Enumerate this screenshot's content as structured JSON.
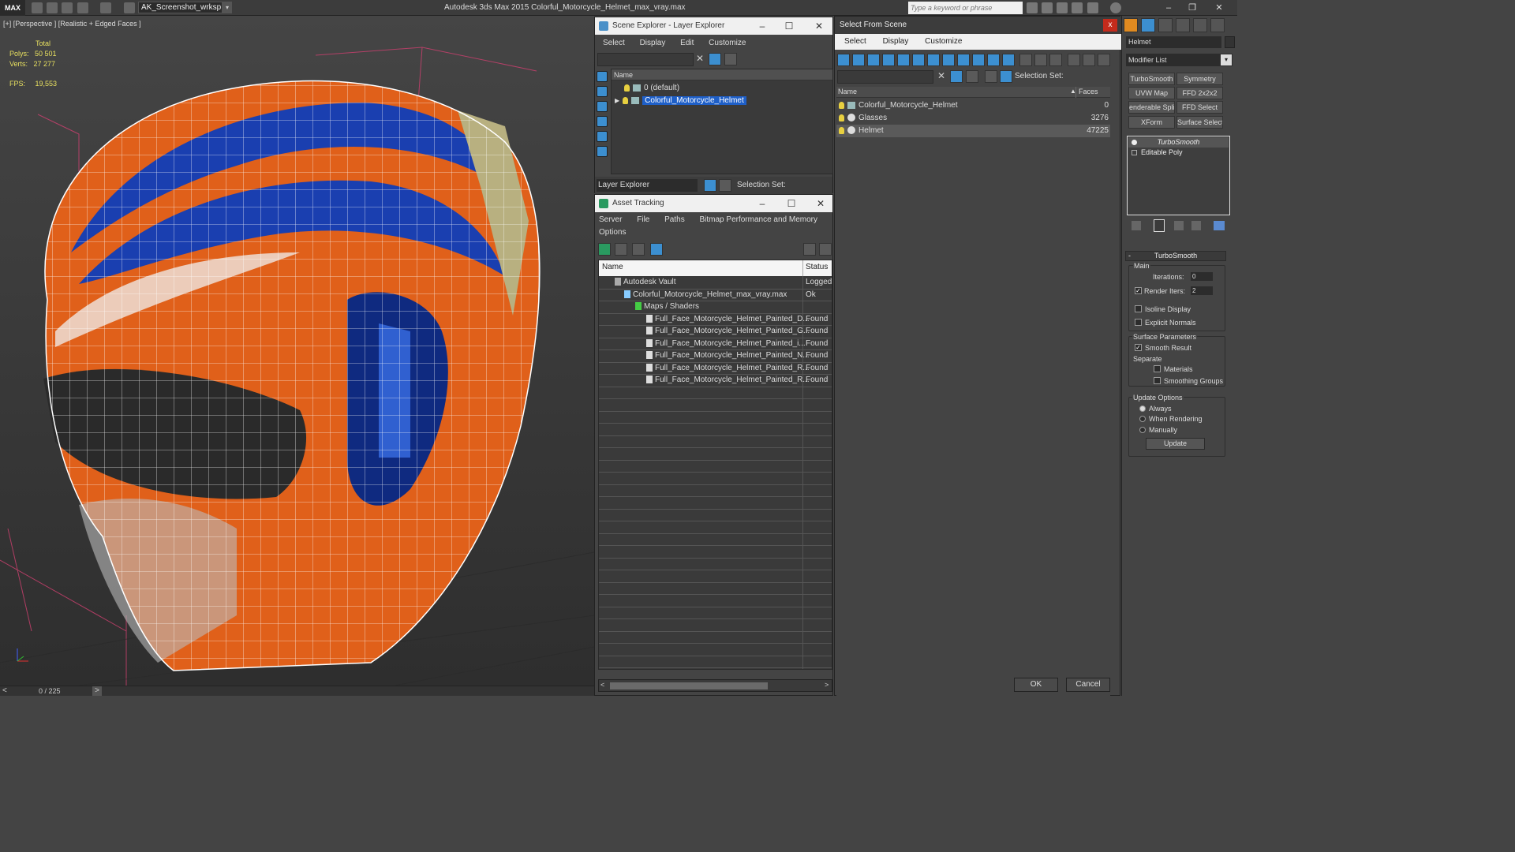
{
  "titlebar": {
    "logo": "MAX",
    "workspace": "AK_Screenshot_wrksp",
    "app_title": "Autodesk 3ds Max  2015    Colorful_Motorcycle_Helmet_max_vray.max",
    "search_placeholder": "Type a keyword or phrase"
  },
  "viewport": {
    "label": "[+] [Perspective ] [Realistic + Edged Faces ]",
    "stats_total": "Total",
    "polys_label": "Polys:",
    "polys_value": "50 501",
    "verts_label": "Verts:",
    "verts_value": "27 277",
    "fps_label": "FPS:",
    "fps_value": "19,553",
    "timeline": "0 / 225"
  },
  "scene_explorer": {
    "title": "Scene Explorer - Layer Explorer",
    "menu": [
      "Select",
      "Display",
      "Edit",
      "Customize"
    ],
    "column_name": "Name",
    "layers": [
      "0 (default)",
      "Colorful_Motorcycle_Helmet"
    ],
    "bottom_dropdown": "Layer Explorer",
    "selection_set_label": "Selection Set:"
  },
  "asset_tracking": {
    "title": "Asset Tracking",
    "menu": [
      "Server",
      "File",
      "Paths",
      "Bitmap Performance and Memory",
      "Options"
    ],
    "columns": [
      "Name",
      "Status"
    ],
    "rows": [
      {
        "name": "Autodesk Vault",
        "status": "Logged"
      },
      {
        "name": "Colorful_Motorcycle_Helmet_max_vray.max",
        "status": "Ok"
      },
      {
        "name": "Maps / Shaders",
        "status": ""
      },
      {
        "name": "Full_Face_Motorcycle_Helmet_Painted_D...",
        "status": "Found"
      },
      {
        "name": "Full_Face_Motorcycle_Helmet_Painted_G...",
        "status": "Found"
      },
      {
        "name": "Full_Face_Motorcycle_Helmet_Painted_i...",
        "status": "Found"
      },
      {
        "name": "Full_Face_Motorcycle_Helmet_Painted_N...",
        "status": "Found"
      },
      {
        "name": "Full_Face_Motorcycle_Helmet_Painted_R...",
        "status": "Found"
      },
      {
        "name": "Full_Face_Motorcycle_Helmet_Painted_R...",
        "status": "Found"
      }
    ]
  },
  "select_from_scene": {
    "title": "Select From Scene",
    "close": "x",
    "menu": [
      "Select",
      "Display",
      "Customize"
    ],
    "selection_set_label": "Selection Set:",
    "columns": [
      "Name",
      "Faces"
    ],
    "objects": [
      {
        "name": "Colorful_Motorcycle_Helmet",
        "faces": "0"
      },
      {
        "name": "Glasses",
        "faces": "3276"
      },
      {
        "name": "Helmet",
        "faces": "47225"
      }
    ],
    "ok": "OK",
    "cancel": "Cancel"
  },
  "command_panel": {
    "object_name": "Helmet",
    "modifier_list": "Modifier List",
    "modifier_buttons": [
      "TurboSmooth",
      "Symmetry",
      "UVW Map",
      "FFD 2x2x2",
      "enderable Spli",
      "FFD Select",
      "XForm",
      "Surface Select"
    ],
    "stack": [
      "TurboSmooth",
      "Editable Poly"
    ],
    "rollout_title": "TurboSmooth",
    "main_label": "Main",
    "iterations_label": "Iterations:",
    "iterations_value": "0",
    "render_iters_label": "Render Iters:",
    "render_iters_value": "2",
    "isoline_label": "Isoline Display",
    "explicit_normals_label": "Explicit Normals",
    "surface_params_label": "Surface Parameters",
    "smooth_result_label": "Smooth Result",
    "separate_label": "Separate",
    "materials_label": "Materials",
    "smoothing_groups_label": "Smoothing Groups",
    "update_options_label": "Update Options",
    "always_label": "Always",
    "when_rendering_label": "When Rendering",
    "manually_label": "Manually",
    "update_button": "Update"
  },
  "colors": {
    "selection": "#1e5fc8",
    "helmet_orange": "#e0601a",
    "helmet_blue": "#1a3fb0"
  }
}
